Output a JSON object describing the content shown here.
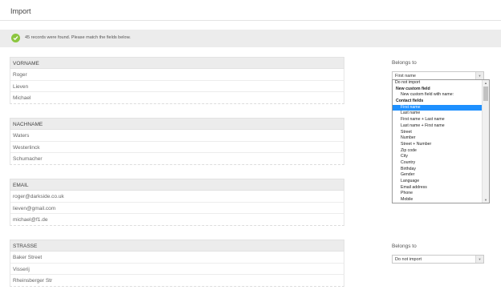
{
  "header": {
    "title": "Import"
  },
  "notice": {
    "icon": "check-circle-icon",
    "text": "45 records were found. Please match the fields below."
  },
  "groups": [
    {
      "name": "VORNAME",
      "values": [
        "Roger",
        "Lieven",
        "Michael"
      ]
    },
    {
      "name": "NACHNAME",
      "values": [
        "Waters",
        "Westerlinck",
        "Schumacher"
      ]
    },
    {
      "name": "EMAIL",
      "values": [
        "roger@darkside.co.uk",
        "lieven@gmail.com",
        "michael@f1.de"
      ]
    },
    {
      "name": "STRASSE",
      "values": [
        "Baker Street",
        "Visserij",
        "Rheinsberger Str"
      ]
    }
  ],
  "mapping1": {
    "label": "Belongs to",
    "selected": "First name",
    "options": [
      {
        "text": "Do not import",
        "kind": "item0"
      },
      {
        "text": "New custom field",
        "kind": "group"
      },
      {
        "text": "New custom field with name:",
        "kind": "item"
      },
      {
        "text": "Contact fields",
        "kind": "group"
      },
      {
        "text": "First name",
        "kind": "item",
        "selected": true
      },
      {
        "text": "Last name",
        "kind": "item"
      },
      {
        "text": "First name + Last name",
        "kind": "item"
      },
      {
        "text": "Last name + First name",
        "kind": "item"
      },
      {
        "text": "Street",
        "kind": "item"
      },
      {
        "text": "Number",
        "kind": "item"
      },
      {
        "text": "Street + Number",
        "kind": "item"
      },
      {
        "text": "Zip code",
        "kind": "item"
      },
      {
        "text": "City",
        "kind": "item"
      },
      {
        "text": "Country",
        "kind": "item"
      },
      {
        "text": "Birthday",
        "kind": "item"
      },
      {
        "text": "Gender",
        "kind": "item"
      },
      {
        "text": "Language",
        "kind": "item"
      },
      {
        "text": "Email address",
        "kind": "item"
      },
      {
        "text": "Phone",
        "kind": "item"
      },
      {
        "text": "Mobile",
        "kind": "item"
      }
    ]
  },
  "mapping2": {
    "label": "Belongs to",
    "selected": "Do not import"
  },
  "colors": {
    "check": "#8cc63f",
    "selected": "#1e90ff",
    "header_bg": "#ececec"
  }
}
